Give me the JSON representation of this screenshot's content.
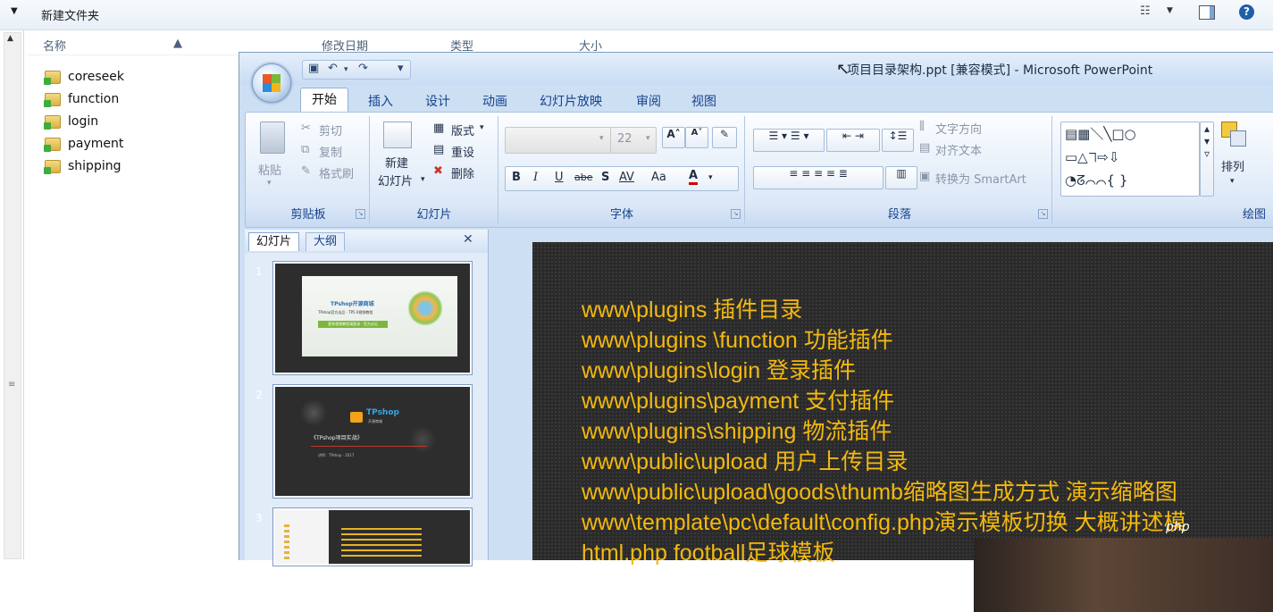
{
  "explorer": {
    "folder_title": "新建文件夹",
    "columns": {
      "name": "名称",
      "modified": "修改日期",
      "type": "类型",
      "size": "大小"
    },
    "folders": [
      "coreseek",
      "function",
      "login",
      "payment",
      "shipping"
    ],
    "help_label": "?"
  },
  "ppt": {
    "window_title": "项目目录架构.ppt [兼容模式] - Microsoft PowerPoint",
    "tabs": [
      "开始",
      "插入",
      "设计",
      "动画",
      "幻灯片放映",
      "审阅",
      "视图"
    ],
    "active_tab": "开始",
    "groups": {
      "clipboard": {
        "label": "剪贴板",
        "paste": "粘贴",
        "cut": "剪切",
        "copy": "复制",
        "format_painter": "格式刷"
      },
      "slides": {
        "label": "幻灯片",
        "new_slide_line1": "新建",
        "new_slide_line2": "幻灯片",
        "layout": "版式",
        "reset": "重设",
        "delete": "删除"
      },
      "font": {
        "label": "字体",
        "font_size": "22",
        "bold": "B",
        "italic": "I",
        "underline": "U",
        "strike": "abe",
        "shadow": "S",
        "spacing": "AV",
        "case": "Aa",
        "color": "A"
      },
      "paragraph": {
        "label": "段落",
        "text_direction": "文字方向",
        "align_text": "对齐文本",
        "smartart": "转换为 SmartArt"
      },
      "drawing": {
        "label": "绘图",
        "arrange": "排列"
      }
    },
    "pane_tabs": {
      "slides": "幻灯片",
      "outline": "大纲"
    },
    "slide_numbers": [
      "1",
      "2",
      "3"
    ],
    "thumb_texts": {
      "s1_title": "TPshop开源商城",
      "s1_sub": "TPshop官方出品 · TP5.0视频教程",
      "s1_btn": "更多视频教程请登录 · 官方论坛",
      "s2_brand": "TPshop",
      "s2_brand_sub": "开源商城",
      "s2_title": "《TPshop项目实战》",
      "s2_sub": "讲师：TPshop · 2017"
    },
    "slide_lines": [
      "www\\plugins 插件目录",
      "www\\plugins \\function 功能插件",
      "www\\plugins\\login 登录插件",
      "www\\plugins\\payment  支付插件",
      "www\\plugins\\shipping  物流插件",
      "www\\public\\upload 用户上传目录",
      "www\\public\\upload\\goods\\thumb缩略图生成方式 演示缩略图",
      "www\\template\\pc\\default\\config.php演示模板切换 大概讲述模",
      "html.php    football足球模板"
    ],
    "watermark": "php"
  }
}
